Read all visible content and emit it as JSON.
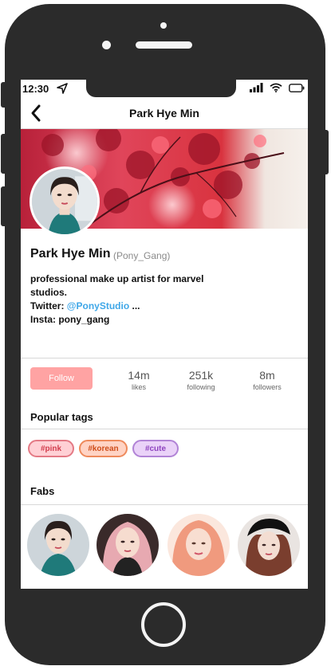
{
  "status_bar": {
    "time": "12:30"
  },
  "header": {
    "title": "Park Hye Min"
  },
  "profile": {
    "name": "Park Hye Min",
    "handle": "(Pony_Gang)",
    "bio_line1": "professional make up artist for marvel",
    "bio_line2": "studios.",
    "twitter_label": "Twitter: ",
    "twitter_handle": "@PonyStudio",
    "twitter_more": " ...",
    "insta_label": "Insta: ",
    "insta_handle": "pony_gang"
  },
  "actions": {
    "follow_label": "Follow"
  },
  "stats": [
    {
      "value": "14m",
      "label": "likes"
    },
    {
      "value": "251k",
      "label": "following"
    },
    {
      "value": "8m",
      "label": "followers"
    }
  ],
  "popular_tags": {
    "title": "Popular tags",
    "tags": [
      "#pink",
      "#korean",
      "#cute"
    ]
  },
  "fabs": {
    "title": "Fabs"
  },
  "colors": {
    "follow_button": "#ffa3a3",
    "link": "#3fa7e8",
    "tag_pink": "#e47a85",
    "tag_korean": "#ee8a5c",
    "tag_cute": "#b183d6"
  }
}
